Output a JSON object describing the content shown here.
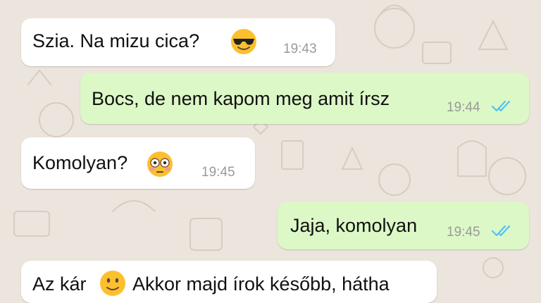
{
  "chat": {
    "messages": [
      {
        "direction": "incoming",
        "text": "Szia. Na mizu cica?",
        "emoji": "smiling-face-with-sunglasses",
        "time": "19:43"
      },
      {
        "direction": "outgoing",
        "text": "Bocs, de nem kapom meg amit írsz",
        "time": "19:44",
        "status": "read"
      },
      {
        "direction": "incoming",
        "text": "Komolyan?",
        "emoji": "flushed-face",
        "time": "19:45"
      },
      {
        "direction": "outgoing",
        "text": "Jaja, komolyan",
        "time": "19:45",
        "status": "read"
      },
      {
        "direction": "incoming",
        "text": "Az kár",
        "emoji": "slightly-smiling-face",
        "text_after": "Akkor majd írok később, hátha"
      }
    ]
  },
  "colors": {
    "background": "#ece5dd",
    "incoming_bubble": "#ffffff",
    "outgoing_bubble": "#dcf8c6",
    "read_ticks": "#4fc3f7",
    "timestamp": "#9a9a9a"
  }
}
